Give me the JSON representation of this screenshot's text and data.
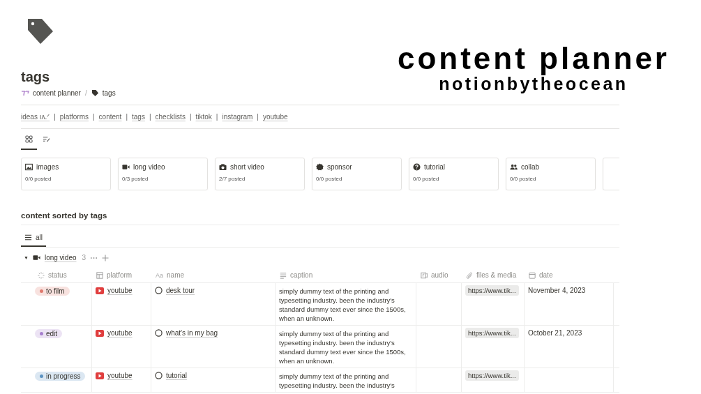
{
  "brand": {
    "title": "content planner",
    "subtitle": "notionbytheocean"
  },
  "page": {
    "title": "tags"
  },
  "breadcrumb": [
    {
      "label": "content planner",
      "kind": "bow"
    },
    {
      "label": "tags",
      "kind": "tag"
    }
  ],
  "breadcrumb_separator": "/",
  "nav_links": [
    "ideas ıʌ.ᐟ",
    "platforms",
    "content",
    "tags",
    "checklists",
    "tiktok",
    "instagram",
    "youtube"
  ],
  "nav_separator": "|",
  "view_tabs": [
    {
      "kind": "gallery",
      "selected": true
    },
    {
      "kind": "list",
      "selected": false
    }
  ],
  "cards": [
    {
      "kind": "image",
      "title": "images",
      "count": "0/0 posted"
    },
    {
      "kind": "video",
      "title": "long video",
      "count": "0/3 posted"
    },
    {
      "kind": "camera",
      "title": "short video",
      "count": "2/7 posted"
    },
    {
      "kind": "badge",
      "title": "sponsor",
      "count": "0/0 posted"
    },
    {
      "kind": "question",
      "title": "tutorial",
      "count": "0/0 posted"
    },
    {
      "kind": "people",
      "title": "collab",
      "count": "0/0 posted"
    }
  ],
  "section": {
    "title": "content sorted by tags",
    "tabs": [
      {
        "label": "all",
        "selected": true
      }
    ]
  },
  "group": {
    "toggle": "▼",
    "label": "long video",
    "count": "3"
  },
  "table": {
    "columns": [
      {
        "kind": "status",
        "label": "status"
      },
      {
        "kind": "platform",
        "label": "platform"
      },
      {
        "kind": "name",
        "label": "name",
        "prefix": "Aa"
      },
      {
        "kind": "caption",
        "label": "caption"
      },
      {
        "kind": "audio",
        "label": "audio"
      },
      {
        "kind": "files",
        "label": "files & media"
      },
      {
        "kind": "date",
        "label": "date"
      }
    ],
    "rows": [
      {
        "status": "to film",
        "color": "#e07a6e",
        "platform": "youtube",
        "name": "desk tour",
        "caption": "simply dummy text of the printing and typesetting industry. been the industry's standard dummy text ever since the 1500s, when an unknown.",
        "file": "https://www.tik...",
        "date": "November 4, 2023"
      },
      {
        "status": "edit",
        "color": "#a77fcf",
        "platform": "youtube",
        "name": "what's in my bag",
        "caption": "simply dummy text of the printing and typesetting industry. been the industry's standard dummy text ever since the 1500s, when an unknown.",
        "file": "https://www.tik...",
        "date": "October 21, 2023"
      },
      {
        "status": "in progress",
        "color": "#5c93c2",
        "platform": "youtube",
        "name": "tutorial",
        "caption": "simply dummy text of the printing and typesetting industry. been the industry's",
        "file": "https://www.tik..."
      }
    ]
  }
}
